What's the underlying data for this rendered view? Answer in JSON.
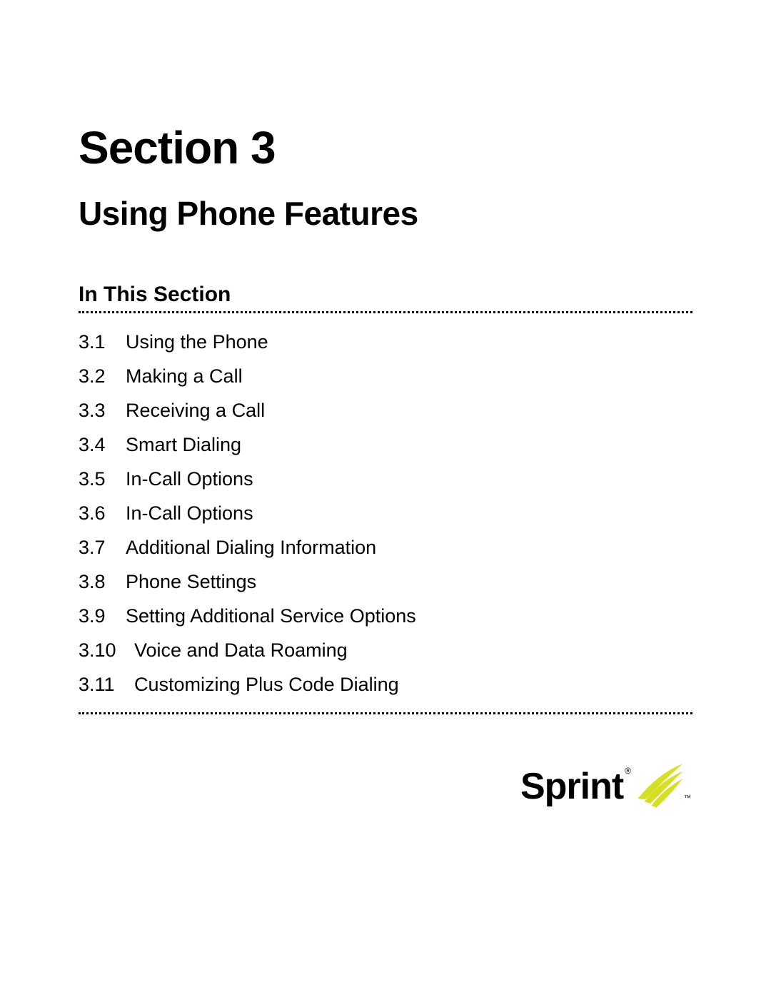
{
  "section_label": "Section 3",
  "section_title": "Using Phone Features",
  "subheading": "In This Section",
  "toc": [
    {
      "num": "3.1",
      "title": "Using the Phone"
    },
    {
      "num": "3.2",
      "title": "Making a Call"
    },
    {
      "num": "3.3",
      "title": "Receiving a Call"
    },
    {
      "num": "3.4",
      "title": "Smart Dialing"
    },
    {
      "num": "3.5",
      "title": "In-Call Options"
    },
    {
      "num": "3.6",
      "title": "In-Call Options"
    },
    {
      "num": "3.7",
      "title": "Additional Dialing Information"
    },
    {
      "num": "3.8",
      "title": "Phone Settings"
    },
    {
      "num": "3.9",
      "title": "Setting Additional Service Options"
    },
    {
      "num": "3.10",
      "title": "Voice and Data Roaming"
    },
    {
      "num": "3.11",
      "title": "Customizing Plus Code Dialing"
    }
  ],
  "brand": {
    "name": "Sprint",
    "color": "#d7df23"
  }
}
